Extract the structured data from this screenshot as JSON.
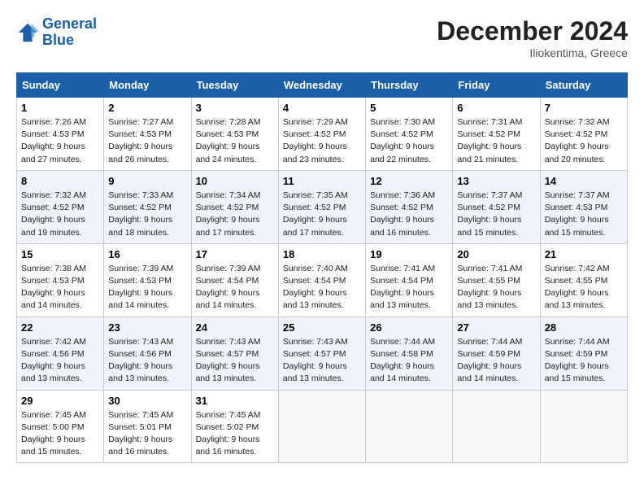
{
  "logo": {
    "line1": "General",
    "line2": "Blue"
  },
  "title": "December 2024",
  "subtitle": "Iliokentima, Greece",
  "days_header": [
    "Sunday",
    "Monday",
    "Tuesday",
    "Wednesday",
    "Thursday",
    "Friday",
    "Saturday"
  ],
  "weeks": [
    [
      {
        "day": "1",
        "sunrise": "Sunrise: 7:26 AM",
        "sunset": "Sunset: 4:53 PM",
        "daylight": "Daylight: 9 hours and 27 minutes."
      },
      {
        "day": "2",
        "sunrise": "Sunrise: 7:27 AM",
        "sunset": "Sunset: 4:53 PM",
        "daylight": "Daylight: 9 hours and 26 minutes."
      },
      {
        "day": "3",
        "sunrise": "Sunrise: 7:28 AM",
        "sunset": "Sunset: 4:53 PM",
        "daylight": "Daylight: 9 hours and 24 minutes."
      },
      {
        "day": "4",
        "sunrise": "Sunrise: 7:29 AM",
        "sunset": "Sunset: 4:52 PM",
        "daylight": "Daylight: 9 hours and 23 minutes."
      },
      {
        "day": "5",
        "sunrise": "Sunrise: 7:30 AM",
        "sunset": "Sunset: 4:52 PM",
        "daylight": "Daylight: 9 hours and 22 minutes."
      },
      {
        "day": "6",
        "sunrise": "Sunrise: 7:31 AM",
        "sunset": "Sunset: 4:52 PM",
        "daylight": "Daylight: 9 hours and 21 minutes."
      },
      {
        "day": "7",
        "sunrise": "Sunrise: 7:32 AM",
        "sunset": "Sunset: 4:52 PM",
        "daylight": "Daylight: 9 hours and 20 minutes."
      }
    ],
    [
      {
        "day": "8",
        "sunrise": "Sunrise: 7:32 AM",
        "sunset": "Sunset: 4:52 PM",
        "daylight": "Daylight: 9 hours and 19 minutes."
      },
      {
        "day": "9",
        "sunrise": "Sunrise: 7:33 AM",
        "sunset": "Sunset: 4:52 PM",
        "daylight": "Daylight: 9 hours and 18 minutes."
      },
      {
        "day": "10",
        "sunrise": "Sunrise: 7:34 AM",
        "sunset": "Sunset: 4:52 PM",
        "daylight": "Daylight: 9 hours and 17 minutes."
      },
      {
        "day": "11",
        "sunrise": "Sunrise: 7:35 AM",
        "sunset": "Sunset: 4:52 PM",
        "daylight": "Daylight: 9 hours and 17 minutes."
      },
      {
        "day": "12",
        "sunrise": "Sunrise: 7:36 AM",
        "sunset": "Sunset: 4:52 PM",
        "daylight": "Daylight: 9 hours and 16 minutes."
      },
      {
        "day": "13",
        "sunrise": "Sunrise: 7:37 AM",
        "sunset": "Sunset: 4:52 PM",
        "daylight": "Daylight: 9 hours and 15 minutes."
      },
      {
        "day": "14",
        "sunrise": "Sunrise: 7:37 AM",
        "sunset": "Sunset: 4:53 PM",
        "daylight": "Daylight: 9 hours and 15 minutes."
      }
    ],
    [
      {
        "day": "15",
        "sunrise": "Sunrise: 7:38 AM",
        "sunset": "Sunset: 4:53 PM",
        "daylight": "Daylight: 9 hours and 14 minutes."
      },
      {
        "day": "16",
        "sunrise": "Sunrise: 7:39 AM",
        "sunset": "Sunset: 4:53 PM",
        "daylight": "Daylight: 9 hours and 14 minutes."
      },
      {
        "day": "17",
        "sunrise": "Sunrise: 7:39 AM",
        "sunset": "Sunset: 4:54 PM",
        "daylight": "Daylight: 9 hours and 14 minutes."
      },
      {
        "day": "18",
        "sunrise": "Sunrise: 7:40 AM",
        "sunset": "Sunset: 4:54 PM",
        "daylight": "Daylight: 9 hours and 13 minutes."
      },
      {
        "day": "19",
        "sunrise": "Sunrise: 7:41 AM",
        "sunset": "Sunset: 4:54 PM",
        "daylight": "Daylight: 9 hours and 13 minutes."
      },
      {
        "day": "20",
        "sunrise": "Sunrise: 7:41 AM",
        "sunset": "Sunset: 4:55 PM",
        "daylight": "Daylight: 9 hours and 13 minutes."
      },
      {
        "day": "21",
        "sunrise": "Sunrise: 7:42 AM",
        "sunset": "Sunset: 4:55 PM",
        "daylight": "Daylight: 9 hours and 13 minutes."
      }
    ],
    [
      {
        "day": "22",
        "sunrise": "Sunrise: 7:42 AM",
        "sunset": "Sunset: 4:56 PM",
        "daylight": "Daylight: 9 hours and 13 minutes."
      },
      {
        "day": "23",
        "sunrise": "Sunrise: 7:43 AM",
        "sunset": "Sunset: 4:56 PM",
        "daylight": "Daylight: 9 hours and 13 minutes."
      },
      {
        "day": "24",
        "sunrise": "Sunrise: 7:43 AM",
        "sunset": "Sunset: 4:57 PM",
        "daylight": "Daylight: 9 hours and 13 minutes."
      },
      {
        "day": "25",
        "sunrise": "Sunrise: 7:43 AM",
        "sunset": "Sunset: 4:57 PM",
        "daylight": "Daylight: 9 hours and 13 minutes."
      },
      {
        "day": "26",
        "sunrise": "Sunrise: 7:44 AM",
        "sunset": "Sunset: 4:58 PM",
        "daylight": "Daylight: 9 hours and 14 minutes."
      },
      {
        "day": "27",
        "sunrise": "Sunrise: 7:44 AM",
        "sunset": "Sunset: 4:59 PM",
        "daylight": "Daylight: 9 hours and 14 minutes."
      },
      {
        "day": "28",
        "sunrise": "Sunrise: 7:44 AM",
        "sunset": "Sunset: 4:59 PM",
        "daylight": "Daylight: 9 hours and 15 minutes."
      }
    ],
    [
      {
        "day": "29",
        "sunrise": "Sunrise: 7:45 AM",
        "sunset": "Sunset: 5:00 PM",
        "daylight": "Daylight: 9 hours and 15 minutes."
      },
      {
        "day": "30",
        "sunrise": "Sunrise: 7:45 AM",
        "sunset": "Sunset: 5:01 PM",
        "daylight": "Daylight: 9 hours and 16 minutes."
      },
      {
        "day": "31",
        "sunrise": "Sunrise: 7:45 AM",
        "sunset": "Sunset: 5:02 PM",
        "daylight": "Daylight: 9 hours and 16 minutes."
      },
      null,
      null,
      null,
      null
    ]
  ]
}
